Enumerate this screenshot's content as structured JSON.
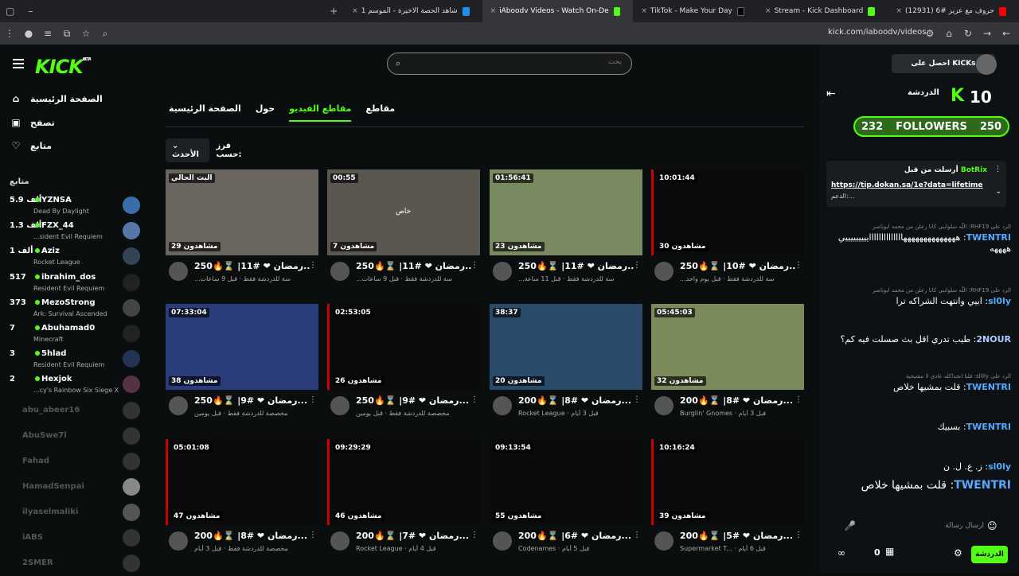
{
  "browser": {
    "tabs": [
      {
        "label": "شاهد الحصة الاخيرة - الموسم 1",
        "color": "#1f8ef1"
      },
      {
        "label": "iAboodv Videos - Watch On-De",
        "color": "#53fc18",
        "active": true
      },
      {
        "label": "TikTok - Make Your Day",
        "color": "#000000"
      },
      {
        "label": "Stream - Kick Dashboard",
        "color": "#53fc18"
      },
      {
        "label": "(12931) حروف مع عزيز #6",
        "color": "#ff0000"
      }
    ],
    "url": "kick.com/iaboodv/videos"
  },
  "sidebar": {
    "logo": "KICK",
    "logo_badge": "BETA",
    "nav": [
      {
        "label": "الصفحة الرئيسية",
        "icon": "home-icon"
      },
      {
        "label": "تصفح",
        "icon": "browse-icon"
      },
      {
        "label": "متابع",
        "icon": "heart-icon"
      }
    ],
    "section_title": "متابع",
    "channels": [
      {
        "name": "YZNSA",
        "viewers": "5.9 ألف",
        "game": "Dead By Daylight",
        "live": true,
        "avatar_color": "#3b6ea8"
      },
      {
        "name": "FZX_44",
        "viewers": "1.3 ألف",
        "game": "...sident Evil Requiem",
        "live": true,
        "avatar_color": "#5577aa"
      },
      {
        "name": "Aziz",
        "viewers": "1 ألف",
        "game": "Rocket League",
        "live": true,
        "avatar_color": "#334455"
      },
      {
        "name": "ibrahim_dos",
        "viewers": "517",
        "game": "Resident Evil Requiem",
        "live": true,
        "avatar_color": "#222222"
      },
      {
        "name": "MezoStrong",
        "viewers": "373",
        "game": "Ark: Survival Ascended",
        "live": true,
        "avatar_color": "#444444"
      },
      {
        "name": "Abuhamad0",
        "viewers": "7",
        "game": "Minecraft",
        "live": true,
        "avatar_color": "#222222"
      },
      {
        "name": "5hlad",
        "viewers": "3",
        "game": "Resident Evil Requiem",
        "live": true,
        "avatar_color": "#223355"
      },
      {
        "name": "Hexjok",
        "viewers": "2",
        "game": "...cy's Rainbow Six Siege X",
        "live": true,
        "avatar_color": "#553344"
      },
      {
        "name": "abu_abeer16",
        "live": false
      },
      {
        "name": "AbuSwe7l",
        "live": false
      },
      {
        "name": "Fahad",
        "live": false
      },
      {
        "name": "HamadSenpai",
        "live": false
      },
      {
        "name": "ilyaselmaliki",
        "live": false
      },
      {
        "name": "iABS",
        "live": false
      },
      {
        "name": "2SMER",
        "live": false
      }
    ]
  },
  "main": {
    "search_placeholder": "بحث",
    "tabs": [
      "الصفحة الرئيسية",
      "حول",
      "مقاطع الفيديو",
      "مقاطع"
    ],
    "active_tab": 2,
    "sort_label": "فرز حسب:",
    "sort_value": "الأحدث",
    "videos": [
      {
        "duration": "البث الحالي",
        "views": "29 مشاهدون",
        "title": "رمضان ❤ #11| ⌛🔥250...",
        "sub": "...سة للدردشة فقط",
        "time": "قبل 9 ساعات",
        "thumb": "#6b6560"
      },
      {
        "duration": "00:55",
        "views": "7 مشاهدون",
        "title": "رمضان ❤ #11| ⌛🔥250...",
        "sub": "...سة للدردشة فقط",
        "time": "قبل 9 ساعات",
        "thumb": "#5a5650",
        "overlay": "خاص"
      },
      {
        "duration": "01:56:41",
        "views": "23 مشاهدون",
        "title": "رمضان ❤ #11| ⌛🔥250...",
        "sub": "...سة للدردشة فقط",
        "time": "قبل 11 ساعة",
        "thumb": "#7a8a60"
      },
      {
        "duration": "10:01:44",
        "views": "30 مشاهدون",
        "title": "رمضان ❤ #10| ⌛🔥250...",
        "sub": "...سة للدردشة فقط",
        "time": "قبل يوم واحد",
        "thumb": "#0a0a0a"
      },
      {
        "duration": "07:33:04",
        "views": "38 مشاهدون",
        "title": "رمضان ❤ #9| ⌛🔥250...",
        "sub": "مخصصة للدردشة فقط",
        "time": "قبل يومين",
        "thumb": "#2a3d7a"
      },
      {
        "duration": "02:53:05",
        "views": "26 مشاهدون",
        "title": "رمضان ❤ #9| ⌛🔥250...",
        "sub": "مخصصة للدردشة فقط",
        "time": "قبل يومين",
        "thumb": "#0a0a0a"
      },
      {
        "duration": "38:37",
        "views": "20 مشاهدون",
        "title": "رمضان ❤ #8| ⌛🔥200...",
        "sub": "Rocket League",
        "time": "قبل 3 أيام",
        "thumb": "#2a4a6a"
      },
      {
        "duration": "05:45:03",
        "views": "32 مشاهدون",
        "title": "رمضان ❤ #8| ⌛🔥200...",
        "sub": "Burglin' Gnomes",
        "time": "قبل 3 أيام",
        "thumb": "#7a8a5a"
      },
      {
        "duration": "05:01:08",
        "views": "47 مشاهدون",
        "title": "رمضان ❤ #8| ⌛🔥200...",
        "sub": "مخصصة للدردشة فقط",
        "time": "قبل 3 أيام",
        "thumb": "#0a0a0a"
      },
      {
        "duration": "09:29:29",
        "views": "46 مشاهدون",
        "title": "رمضان ❤ #7| ⌛🔥200...",
        "sub": "Rocket League",
        "time": "قبل 4 أيام",
        "thumb": "#0a0a0a"
      },
      {
        "duration": "09:13:54",
        "views": "55 مشاهدون",
        "title": "رمضان ❤ #6| ⌛🔥200...",
        "sub": "Codenames",
        "time": "قبل 5 أيام",
        "thumb": "#0a0a0a"
      },
      {
        "duration": "10:16:24",
        "views": "39 مشاهدون",
        "title": "رمضان ❤ #5| ⌛🔥200...",
        "sub": "Supermarket T...",
        "time": "قبل 6 أيام",
        "thumb": "#0a0a0a"
      }
    ]
  },
  "chat": {
    "get_kicks": "احصل على KICKs",
    "title": "الدردشة",
    "kicks_count": "10",
    "followers_current": "232",
    "followers_label": "FOLLOWERS",
    "followers_goal": "250",
    "pinned": {
      "header": "أرسلت من قبل",
      "user": "BotRix",
      "link": "https://tip.dokan.sa/1e?data=lifetime",
      "text": "الدعم:..."
    },
    "messages": [
      {
        "reply": "الرد على RHF19: اللّه سلوانبي كانا رعلن من محمد ابوناصر",
        "user": "TWENTRI",
        "text": "ههههههههههههههاااااااااااااايييييييييي ههههه",
        "color": "#55aaff"
      },
      {
        "reply": "الرد على RHF19: اللّه سلوانبي كانا رعلن من محمد ابوناصر",
        "user": "sl0ly",
        "text": "ابيي وانتهت الشراكه ترا",
        "color": "#55aaff"
      },
      {
        "reply": "",
        "user": "2NOUR",
        "text": "طيب تدري اقل بث صسلت فيه كم؟",
        "color": "#aaccff"
      },
      {
        "reply": "الرد على sl0ly: فلنا انحداكله عادي لا مشيجية",
        "user": "TWENTRI",
        "text": "قلت بمشيها خلاص",
        "color": "#55aaff"
      },
      {
        "reply": "",
        "user": "TWENTRI",
        "text": "بسبيك",
        "color": "#55aaff"
      },
      {
        "reply": "",
        "user": "sl0ly",
        "text": "ز. ع. ل. ن",
        "color": "#55aaff"
      },
      {
        "reply": "",
        "user": "TWENTRI",
        "text": "قلت بمشيها خلاص",
        "color": "#55aaff"
      }
    ],
    "input_placeholder": "ارسال رسالة",
    "send_label": "الدردشة",
    "bottom_count": "0"
  }
}
